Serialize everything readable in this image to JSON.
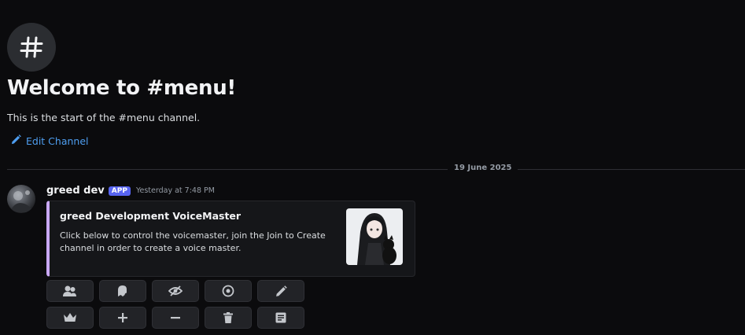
{
  "channel": {
    "icon": "hash-icon",
    "welcome_title": "Welcome to #menu!",
    "welcome_subtitle": "This is the start of the #menu channel.",
    "edit_label": "Edit Channel"
  },
  "divider": {
    "date": "19 June 2025"
  },
  "message": {
    "username": "greed dev",
    "badge": "APP",
    "timestamp": "Yesterday at 7:48 PM",
    "embed": {
      "accent_color": "#c9a8f5",
      "title": "greed Development VoiceMaster",
      "description": "Click below to control the voicemaster, join the Join to Create channel in order to create a voice master."
    },
    "buttons_row1": [
      "users-icon",
      "ghost-icon",
      "eye-off-icon",
      "eye-icon",
      "pencil-icon"
    ],
    "buttons_row2": [
      "crown-icon",
      "plus-icon",
      "minus-icon",
      "trash-icon",
      "notes-icon"
    ]
  },
  "colors": {
    "background": "#0b0b0d",
    "link": "#4e9ef0",
    "badge": "#5865f2"
  }
}
